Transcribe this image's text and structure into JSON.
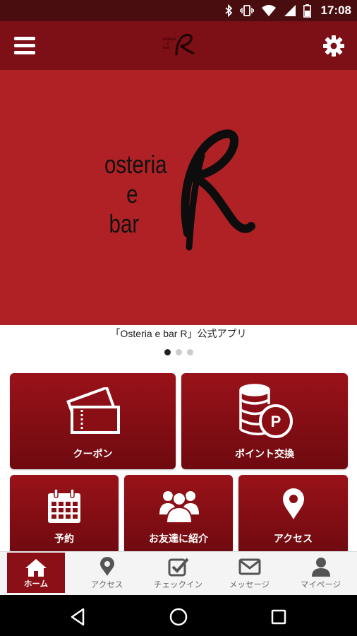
{
  "status_bar": {
    "time": "17:08",
    "icons": [
      "bluetooth-icon",
      "vibrate-icon",
      "wifi-icon",
      "signal-icon",
      "battery-icon"
    ]
  },
  "app_bar": {
    "menu_icon": "hamburger-menu-icon",
    "settings_icon": "gear-icon",
    "logo": "osteria-e-bar-R-logo"
  },
  "hero": {
    "logo_lines": [
      "osteria",
      "e",
      "bar"
    ],
    "logo_letter": "R"
  },
  "caption": "「Osteria e bar R」公式アプリ",
  "carousel": {
    "count": 3,
    "active": 0
  },
  "tiles": {
    "coupon": "クーポン",
    "points": "ポイント交換",
    "reserve": "予約",
    "refer": "お友達に紹介",
    "access": "アクセス"
  },
  "bottom_nav": {
    "home": "ホーム",
    "access": "アクセス",
    "checkin": "チェックイン",
    "message": "メッセージ",
    "mypage": "マイページ"
  },
  "colors": {
    "brand": "#7d0f16",
    "hero_bg": "#b02125",
    "tile_top": "#9a1219",
    "tile_bottom": "#6e0a10",
    "nav_active": "#8b0f16"
  }
}
